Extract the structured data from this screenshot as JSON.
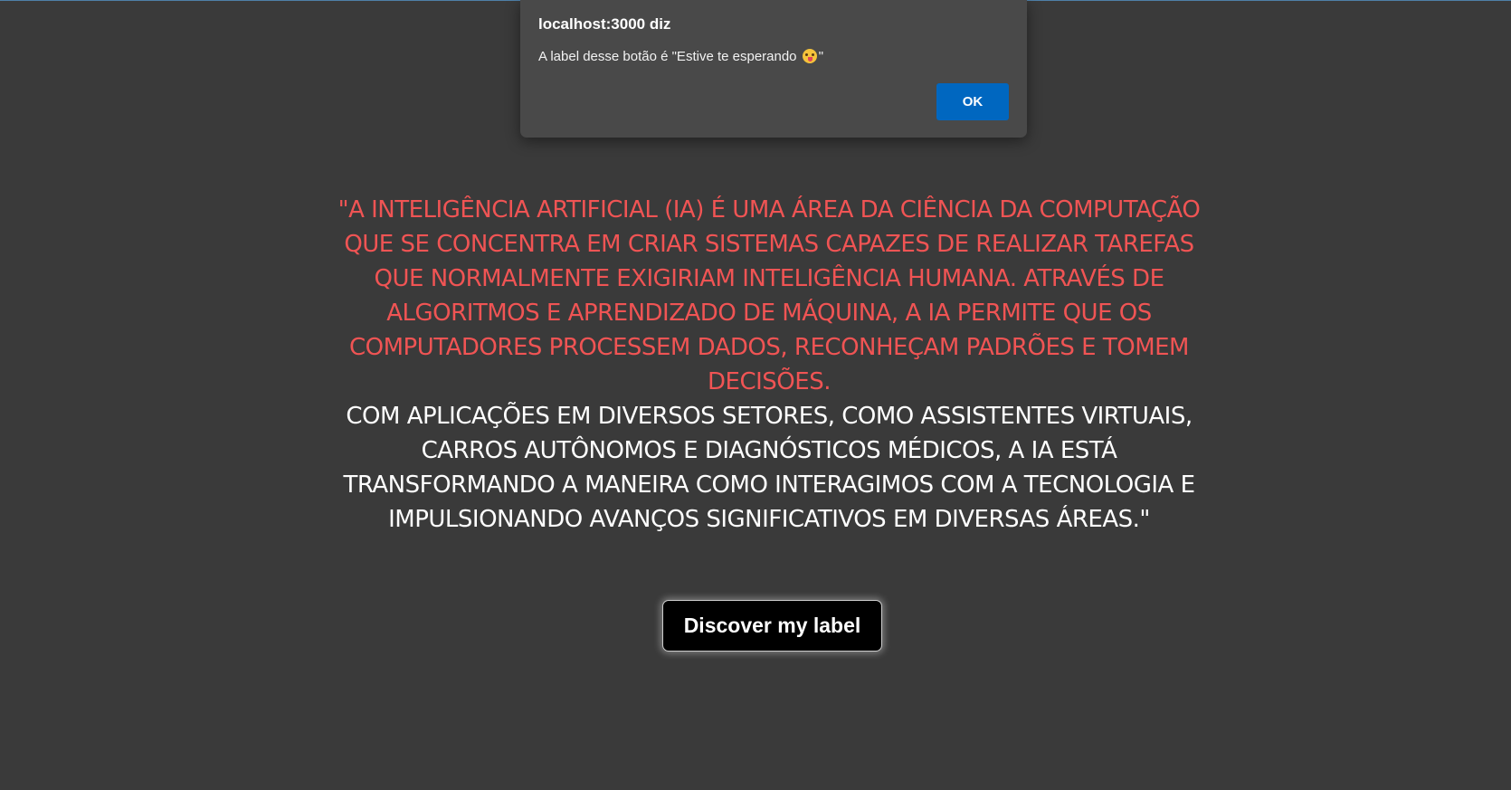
{
  "dialog": {
    "title": "localhost:3000 diz",
    "message_before": "A label desse botão é \"Estive te esperando ",
    "message_emoji": "face-with-tongue-emoji",
    "message_after": "\"",
    "ok_label": "OK",
    "ok_color": "#0067c0"
  },
  "quote": {
    "red_text": "\"A inteligência artificial (IA) é uma área da ciência da computação que se concentra em criar sistemas capazes de realizar tarefas que normalmente exigiriam inteligência humana. Através de algoritmos e aprendizado de máquina, a IA permite que os computadores processem dados, reconheçam padrões e tomem decisões.",
    "white_text": "Com aplicações em diversos setores, como assistentes virtuais, carros autônomos e diagnósticos médicos, a IA está transformando a maneira como interagimos com a tecnologia e impulsionando avanços significativos em diversas áreas.\"",
    "red_color": "#f05454"
  },
  "button": {
    "label": "Discover my label"
  },
  "colors": {
    "background": "#3a3a3a",
    "dialog_background": "#494949"
  }
}
